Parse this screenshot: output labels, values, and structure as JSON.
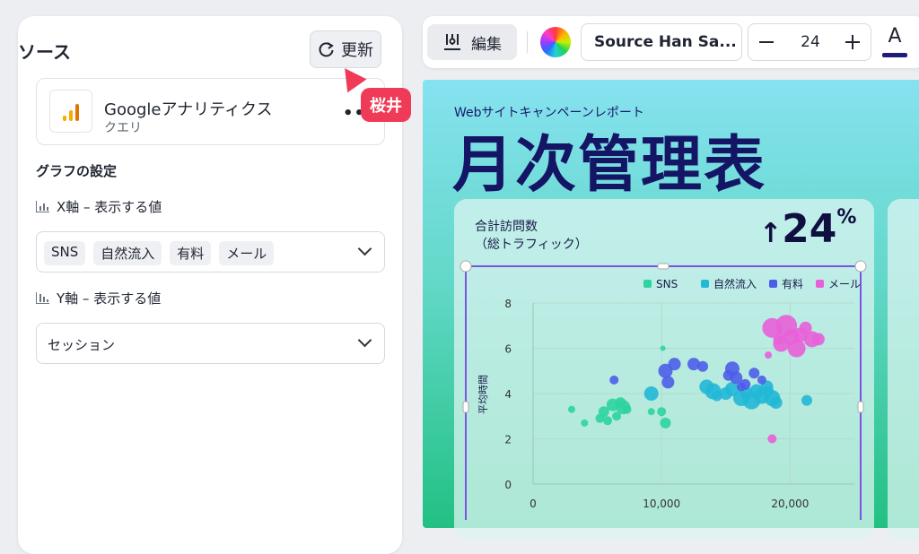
{
  "panel": {
    "title": "ソース",
    "refresh_label": "更新",
    "data_source": {
      "name": "Googleアナリティクス",
      "subtitle": "クエリ",
      "more": "••"
    },
    "graph_settings": "グラフの設定",
    "x_axis": {
      "label": "X軸 – 表示する値",
      "chips": [
        "SNS",
        "自然流入",
        "有料",
        "メール"
      ]
    },
    "y_axis": {
      "label": "Y軸 – 表示する値",
      "value": "セッション"
    }
  },
  "collaborator": {
    "name": "桜井",
    "color": "#ef3b57"
  },
  "toolbar": {
    "edit_label": "編集",
    "font_name": "Source Han Sa...",
    "font_size": "24",
    "text_color_glyph": "A",
    "text_color": "#1e1e7a"
  },
  "report": {
    "subtitle": "Webサイトキャンペーンレポート",
    "title": "月次管理表",
    "card_label_line1": "合計訪問数",
    "card_label_line2": "（総トラフィック）",
    "kpi_arrow": "↑",
    "kpi_value": "24",
    "kpi_unit": "%"
  },
  "chart_data": {
    "type": "scatter",
    "ylabel": "平均時間",
    "xlim": [
      0,
      25000
    ],
    "ylim": [
      0,
      8
    ],
    "xticks": [
      "0",
      "10,000",
      "20,000"
    ],
    "yticks": [
      "0",
      "2",
      "4",
      "6",
      "8"
    ],
    "legend_position": "top-right",
    "series": [
      {
        "name": "SNS",
        "color": "#2dd4a0",
        "points": [
          [
            3000,
            3.3,
            4
          ],
          [
            4000,
            2.7,
            4
          ],
          [
            5200,
            2.9,
            5
          ],
          [
            5500,
            3.2,
            6
          ],
          [
            5800,
            2.8,
            5
          ],
          [
            6200,
            3.5,
            7
          ],
          [
            6500,
            3.0,
            5
          ],
          [
            6800,
            3.6,
            6
          ],
          [
            7000,
            3.4,
            8
          ],
          [
            7300,
            3.3,
            5
          ],
          [
            9200,
            3.2,
            4
          ],
          [
            10000,
            3.2,
            5
          ],
          [
            10300,
            2.7,
            6
          ],
          [
            10100,
            6.0,
            3
          ]
        ]
      },
      {
        "name": "自然流入",
        "color": "#22b8d6",
        "points": [
          [
            9200,
            4.0,
            8
          ],
          [
            13500,
            4.3,
            8
          ],
          [
            14000,
            4.1,
            9
          ],
          [
            14300,
            3.9,
            6
          ],
          [
            15000,
            4.0,
            7
          ],
          [
            15500,
            4.2,
            8
          ],
          [
            16200,
            3.8,
            9
          ],
          [
            16600,
            4.0,
            7
          ],
          [
            17000,
            3.7,
            10
          ],
          [
            17400,
            4.1,
            8
          ],
          [
            17800,
            3.9,
            9
          ],
          [
            18200,
            4.3,
            7
          ],
          [
            18600,
            3.8,
            9
          ],
          [
            18900,
            3.6,
            7
          ],
          [
            18300,
            4.1,
            6
          ],
          [
            21300,
            3.7,
            6
          ]
        ]
      },
      {
        "name": "有料",
        "color": "#4c5ee8",
        "points": [
          [
            6300,
            4.6,
            5
          ],
          [
            10300,
            5.0,
            8
          ],
          [
            10500,
            4.5,
            7
          ],
          [
            11000,
            5.3,
            7
          ],
          [
            12500,
            5.3,
            7
          ],
          [
            13200,
            5.2,
            6
          ],
          [
            15500,
            5.1,
            8
          ],
          [
            15800,
            4.7,
            7
          ],
          [
            16200,
            4.3,
            5
          ],
          [
            16500,
            4.4,
            6
          ],
          [
            17200,
            4.9,
            6
          ],
          [
            17800,
            4.6,
            5
          ],
          [
            15200,
            4.8,
            6
          ]
        ]
      },
      {
        "name": "メール",
        "color": "#e860d8",
        "points": [
          [
            18600,
            6.9,
            11
          ],
          [
            19300,
            6.2,
            9
          ],
          [
            19700,
            7.0,
            12
          ],
          [
            20100,
            6.5,
            9
          ],
          [
            20500,
            6.0,
            10
          ],
          [
            20800,
            6.6,
            8
          ],
          [
            21200,
            6.9,
            7
          ],
          [
            21700,
            6.4,
            9
          ],
          [
            22200,
            6.4,
            7
          ],
          [
            18300,
            5.7,
            4
          ],
          [
            18600,
            2.0,
            5
          ],
          [
            19100,
            6.4,
            6
          ]
        ]
      }
    ]
  }
}
